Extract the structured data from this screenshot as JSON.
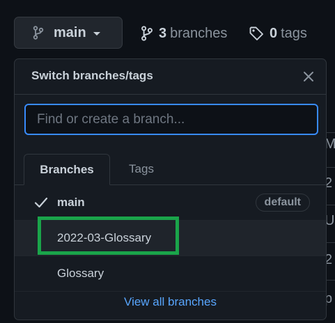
{
  "top": {
    "branch_button_label": "main",
    "branches_count": "3",
    "branches_label": "branches",
    "tags_count": "0",
    "tags_label": "tags"
  },
  "popup": {
    "title": "Switch branches/tags",
    "filter_placeholder": "Find or create a branch...",
    "tabs": [
      {
        "label": "Branches",
        "active": true
      },
      {
        "label": "Tags",
        "active": false
      }
    ],
    "branches": [
      {
        "name": "main",
        "current": true,
        "badge": "default"
      },
      {
        "name": "2022-03-Glossary",
        "current": false,
        "badge": ""
      },
      {
        "name": "Glossary",
        "current": false,
        "badge": ""
      }
    ],
    "view_all_label": "View all branches"
  },
  "background": {
    "row_glyphs": [
      "M",
      "2",
      "U",
      "2",
      "p"
    ]
  },
  "colors": {
    "page_bg": "#0d1117",
    "popup_bg": "#161b22",
    "accent_blue": "#388bfd",
    "link_blue": "#58a6ff",
    "highlight_green": "#1aa44a"
  },
  "icons": {
    "branch_button": "git-branch-icon",
    "branches_meta": "git-branch-icon",
    "tags_meta": "tag-icon",
    "close": "close-icon",
    "current_branch": "check-icon"
  }
}
